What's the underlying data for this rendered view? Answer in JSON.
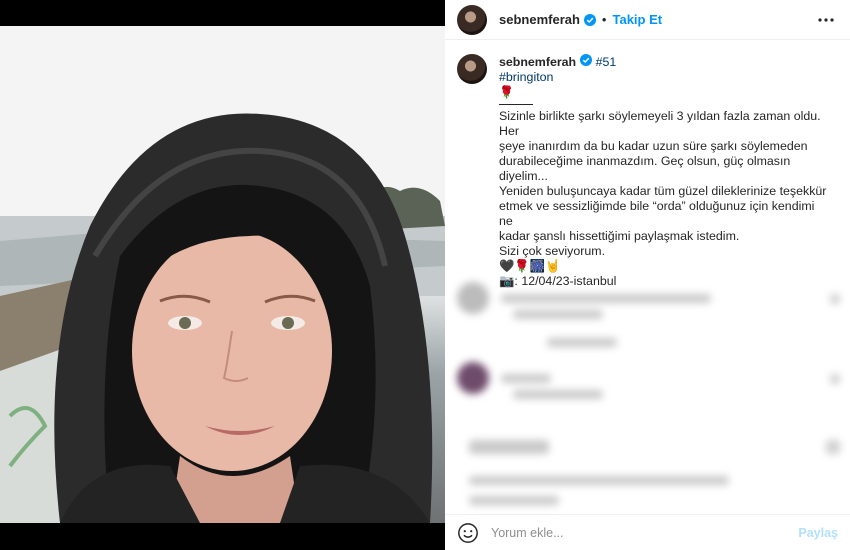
{
  "post": {
    "username": "sebnemferah",
    "separator": "•",
    "follow_label": "Takip Et",
    "more_icon": "more-horizontal-icon"
  },
  "caption": {
    "username": "sebnemferah",
    "number_tag": "#51",
    "hashtag": "#bringiton",
    "rose": "🌹",
    "lines": [
      "Sizinle birlikte şarkı söylemeyeli 3 yıldan fazla zaman oldu. Her",
      "şeye inanırdım da bu kadar uzun süre şarkı söylemeden",
      "durabileceğime inanmazdım. Geç olsun, güç olmasın diyelim...",
      "Yeniden buluşuncaya kadar tüm güzel dileklerinize teşekkür",
      "etmek ve sessizliğimde bile “orda” olduğunuz için kendimi ne",
      "kadar şanslı hissettiğimi paylaşmak istedim.",
      "Sizi çok seviyorum."
    ],
    "emojis": "🖤🌹🎆🤘",
    "date_line": "📷: 12/04/23-istanbul"
  },
  "footer": {
    "placeholder": "Yorum ekle...",
    "post_label": "Paylaş",
    "emoji_icon": "smile-icon"
  },
  "colors": {
    "accent": "#0095f6",
    "link": "#00376b",
    "post_disabled": "#b2dffc"
  }
}
